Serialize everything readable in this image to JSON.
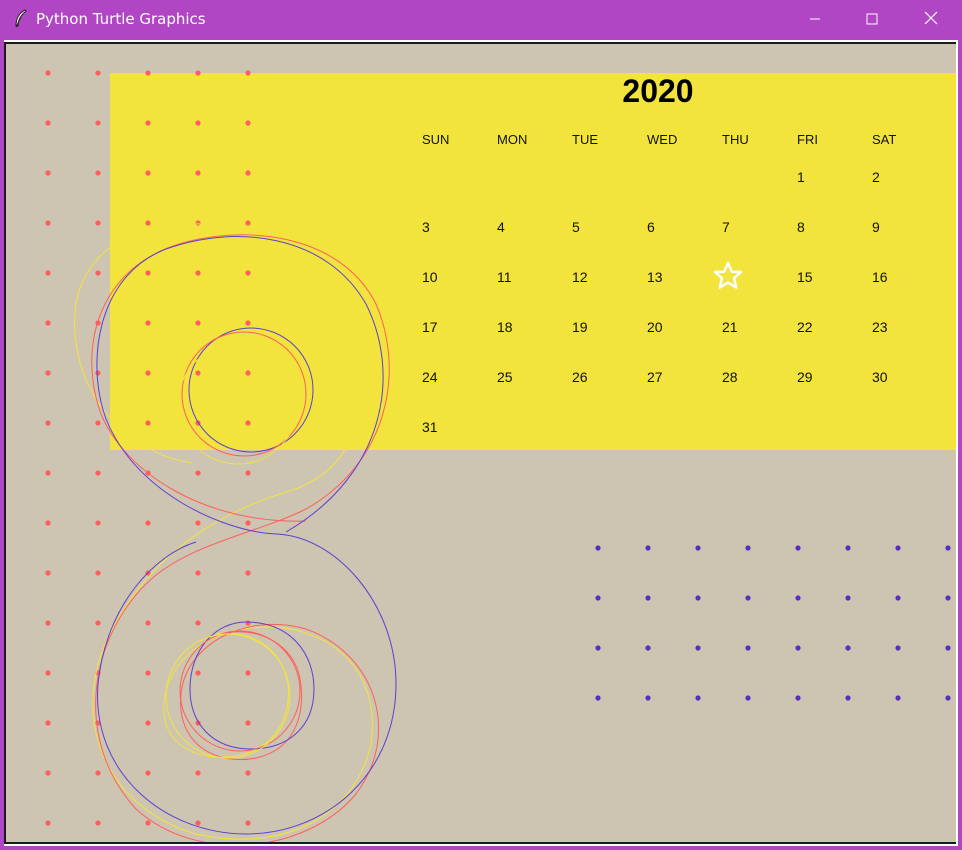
{
  "window": {
    "title": "Python Turtle Graphics",
    "controls": {
      "minimize": "minimize",
      "maximize": "maximize",
      "close": "close"
    }
  },
  "colors": {
    "titlebar": "#b046c4",
    "canvas_bg": "#cdc5b1",
    "calendar_bg": "#f2e43c",
    "dot_red": "#ff5e5e",
    "dot_purple": "#5a2ec2",
    "curve_purple": "#5b3fd1",
    "curve_red": "#ff5e5e",
    "curve_yellow": "#f2e43c",
    "star": "#ffffff"
  },
  "calendar": {
    "year": "2020",
    "weekdays": [
      "SUN",
      "MON",
      "TUE",
      "WED",
      "THU",
      "FRI",
      "SAT"
    ],
    "weeks": [
      [
        "",
        "",
        "",
        "",
        "",
        "1",
        "2"
      ],
      [
        "3",
        "4",
        "5",
        "6",
        "7",
        "8",
        "9"
      ],
      [
        "10",
        "11",
        "12",
        "13",
        "",
        "15",
        "16"
      ],
      [
        "17",
        "18",
        "19",
        "20",
        "21",
        "22",
        "23"
      ],
      [
        "24",
        "25",
        "26",
        "27",
        "28",
        "29",
        "30"
      ],
      [
        "31",
        "",
        "",
        "",
        "",
        "",
        ""
      ]
    ],
    "highlighted_day_icon": "star-icon"
  },
  "decorations": {
    "red_dot_grid": {
      "columns": 5,
      "rows": 16
    },
    "purple_dot_grid": {
      "columns": 8,
      "rows": 4
    },
    "figure": "eight-curves"
  }
}
